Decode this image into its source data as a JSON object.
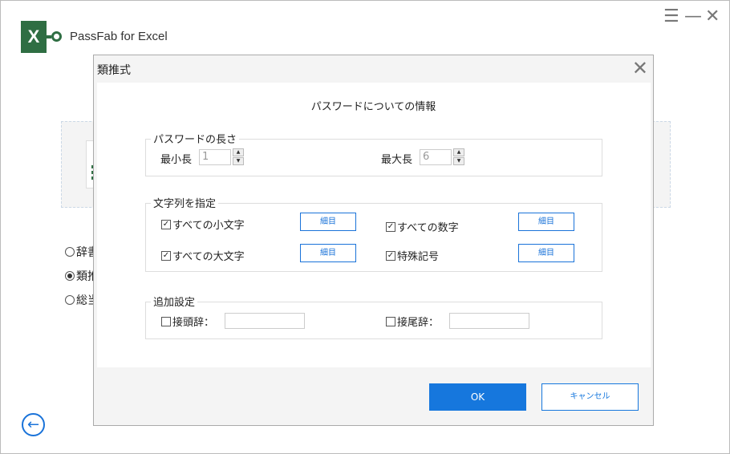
{
  "app": {
    "title": "PassFab for Excel",
    "logo_letter": "X"
  },
  "window_controls": {
    "menu": "☰",
    "minimize": "—",
    "close": "✕"
  },
  "background": {
    "radios": [
      {
        "label": "辞書",
        "checked": false
      },
      {
        "label": "類推",
        "checked": true
      },
      {
        "label": "総当",
        "checked": false
      }
    ],
    "back_icon": "←"
  },
  "dialog": {
    "title": "類推式",
    "close": "✕",
    "heading": "パスワードについての情報",
    "length_group": {
      "legend": "パスワードの長さ",
      "min_label": "最小長",
      "min_value": "1",
      "max_label": "最大長",
      "max_value": "6"
    },
    "charset_group": {
      "legend": "文字列を指定",
      "items": [
        {
          "label": "すべての小文字",
          "checked": true,
          "detail": "細目"
        },
        {
          "label": "すべての数字",
          "checked": true,
          "detail": "細目"
        },
        {
          "label": "すべての大文字",
          "checked": true,
          "detail": "細目"
        },
        {
          "label": "特殊記号",
          "checked": true,
          "detail": "細目"
        }
      ]
    },
    "extra_group": {
      "legend": "追加設定",
      "prefix_label": "接頭辞：",
      "prefix_value": "",
      "suffix_label": "接尾辞：",
      "suffix_value": ""
    },
    "ok": "OK",
    "cancel": "キャンセル"
  },
  "colors": {
    "accent": "#1677dd",
    "brand": "#2f6e43"
  }
}
